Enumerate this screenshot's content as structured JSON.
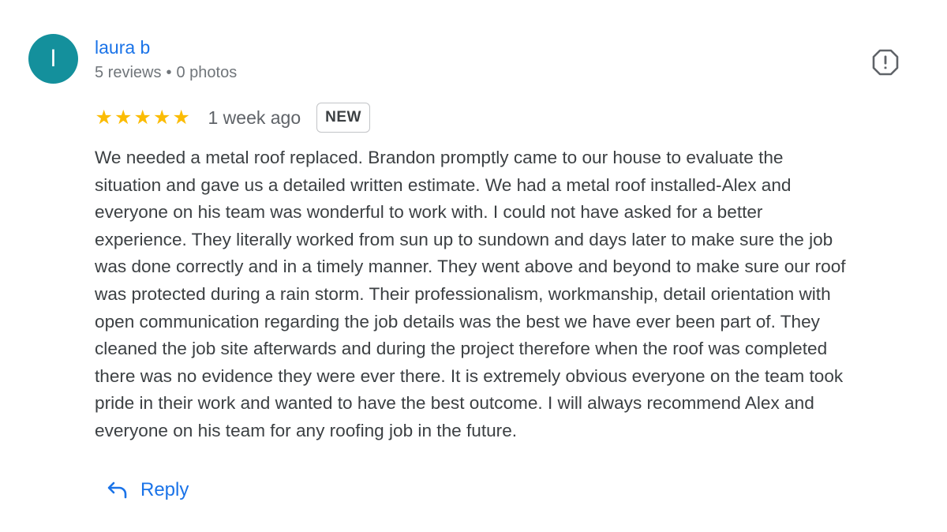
{
  "reviewer": {
    "avatar_letter": "l",
    "name": "laura b",
    "review_count": "5 reviews",
    "separator": "•",
    "photo_count": "0 photos"
  },
  "review": {
    "rating_stars": 5,
    "rating_max": 5,
    "time_ago": "1 week ago",
    "badge": "NEW",
    "text_lines": [
      "We needed a metal roof replaced. Brandon promptly came to our house to evaluate the",
      "situation and gave us a detailed written estimate. We had a metal roof installed-Alex and",
      "everyone on his team was wonderful to work with. I could not have asked for a better",
      "experience. They literally worked from sun up to sundown and days later to make sure the job",
      "was done correctly and in a timely manner. They went above and beyond to make sure our roof",
      "was protected during a rain storm. Their professionalism, workmanship, detail orientation with",
      "open communication regarding the job details was the best we have ever been part of. They",
      "cleaned the job site afterwards and during the project therefore when the roof was completed",
      "there was no evidence they were ever there. It is extremely obvious everyone on the team took",
      "pride in their work and wanted to have the best outcome. I will always recommend Alex and",
      "everyone on his team for any roofing job in the future."
    ]
  },
  "actions": {
    "reply_label": "Reply",
    "report_icon": "report-flag-icon",
    "reply_icon": "reply-arrow-icon"
  },
  "colors": {
    "avatar_bg": "#14909c",
    "link_blue": "#1a73e8",
    "star_yellow": "#fbbc04",
    "text": "#3c4043",
    "secondary_text": "#70757a"
  }
}
